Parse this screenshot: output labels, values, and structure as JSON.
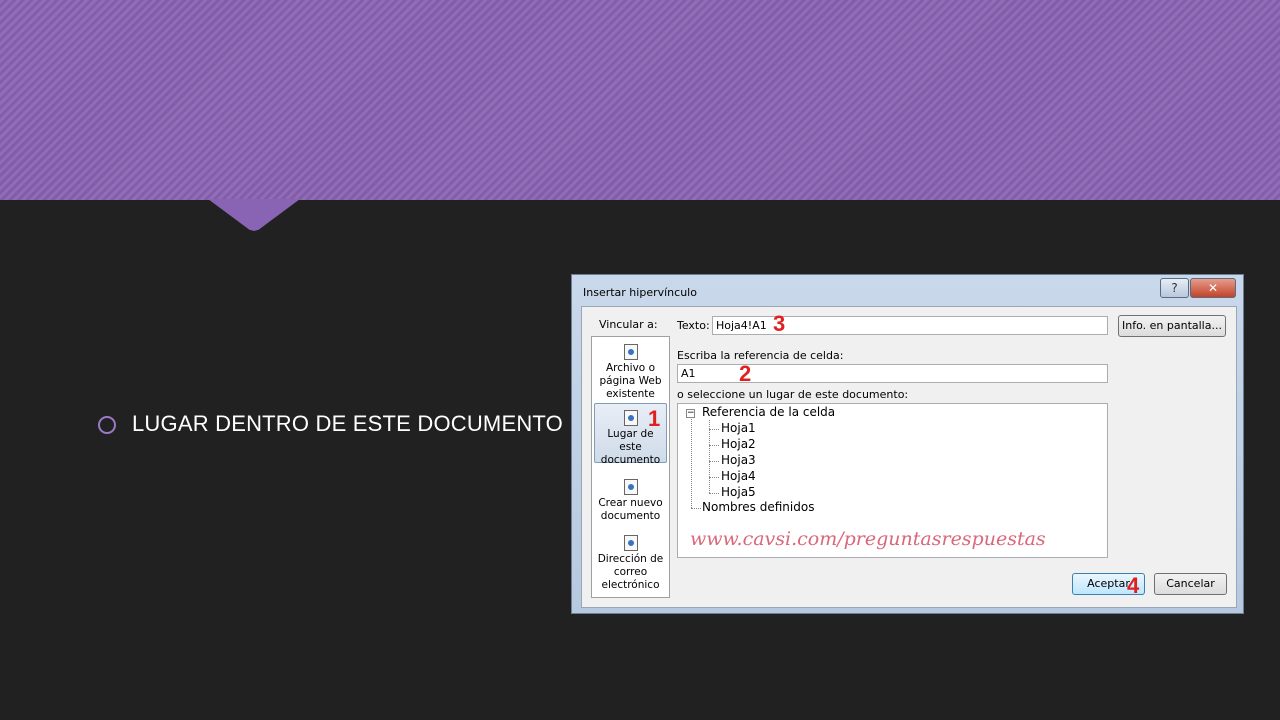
{
  "slide": {
    "bullet_text": "LUGAR DENTRO DE ESTE DOCUMENTO"
  },
  "dialog": {
    "title": "Insertar hipervínculo",
    "help_label": "?",
    "close_label": "✕",
    "link_to_label": "Vincular a:",
    "nav": [
      {
        "label": "Archivo o página Web existente",
        "icon": "globe-file-icon"
      },
      {
        "label": "Lugar de este documento",
        "icon": "document-place-icon"
      },
      {
        "label": "Crear nuevo documento",
        "icon": "new-document-icon"
      },
      {
        "label": "Dirección de correo electrónico",
        "icon": "email-icon"
      }
    ],
    "text_label": "Texto:",
    "text_value": "Hoja4!A1",
    "screentip_button": "Info. en pantalla...",
    "cell_ref_label": "Escriba la referencia de celda:",
    "cell_ref_value": "A1",
    "place_label": "o seleccione un lugar de este documento:",
    "tree": {
      "root": "Referencia de la celda",
      "sheets": [
        "Hoja1",
        "Hoja2",
        "Hoja3",
        "Hoja4",
        "Hoja5"
      ],
      "defined_names": "Nombres definidos"
    },
    "watermark": "www.cavsi.com/preguntasrespuestas",
    "ok_button": "Aceptar",
    "cancel_button": "Cancelar",
    "markers": [
      "1",
      "2",
      "3",
      "4"
    ]
  },
  "colors": {
    "banner": "#8a64b4",
    "background": "#212121",
    "marker": "#e02020"
  }
}
